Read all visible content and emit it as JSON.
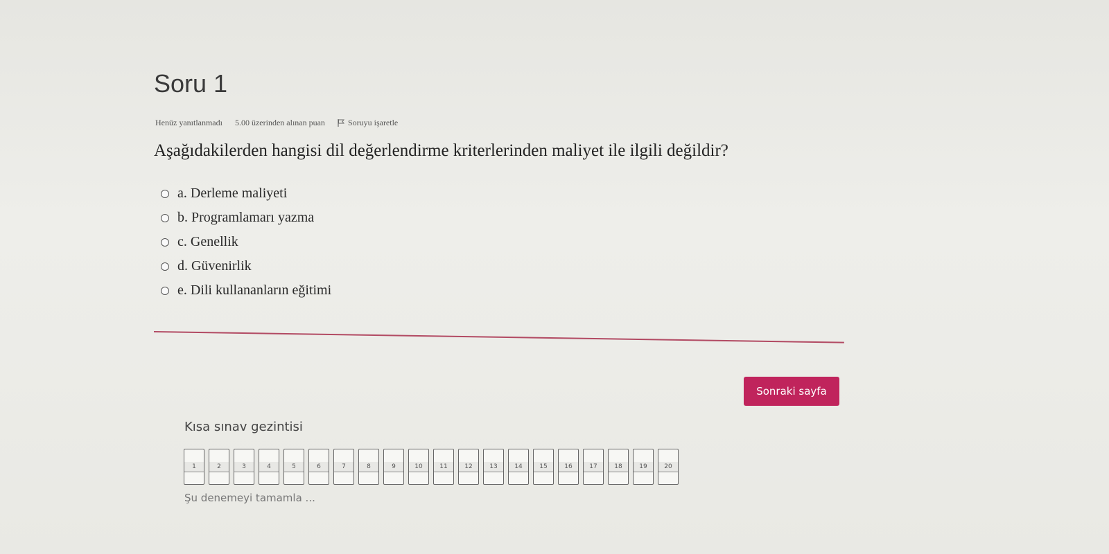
{
  "question": {
    "title": "Soru 1",
    "status": "Henüz yanıtlanmadı",
    "points": "5.00 üzerinden alınan puan",
    "flag_label": "Soruyu işaretle",
    "text": "Aşağıdakilerden hangisi dil değerlendirme kriterlerinden maliyet ile ilgili değildir?",
    "answers": [
      "a. Derleme maliyeti",
      "b. Programlamarı yazma",
      "c. Genellik",
      "d. Güvenirlik",
      "e. Dili kullananların eğitimi"
    ]
  },
  "next_button": "Sonraki sayfa",
  "navigation": {
    "title": "Kısa sınav gezintisi",
    "pages": [
      "1",
      "2",
      "3",
      "4",
      "5",
      "6",
      "7",
      "8",
      "9",
      "10",
      "11",
      "12",
      "13",
      "14",
      "15",
      "16",
      "17",
      "18",
      "19",
      "20"
    ],
    "finish_link": "Şu denemeyi tamamla ..."
  },
  "colors": {
    "accent": "#c0245c",
    "divider": "#b24a63"
  }
}
